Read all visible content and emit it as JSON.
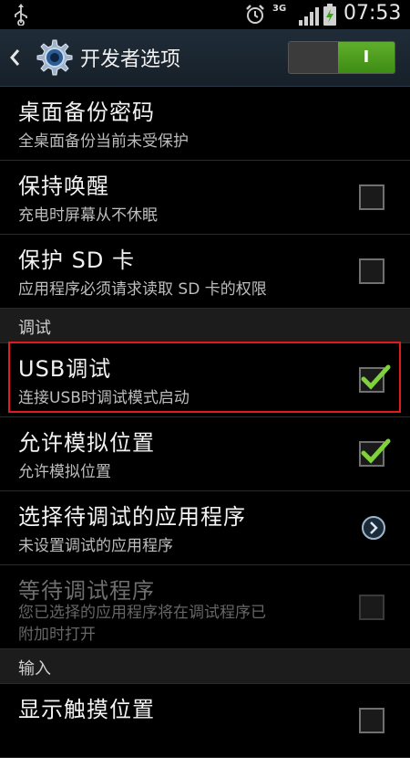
{
  "status_bar": {
    "network": "3G",
    "time": "07:53",
    "icons": [
      "usb-icon",
      "alarm-icon",
      "signal-icon",
      "battery-icon"
    ]
  },
  "action_bar": {
    "title": "开发者选项",
    "toggle_on_label": "I",
    "toggle_state": "on",
    "colors": {
      "accent": "#4c9e20",
      "background": "#1b2631"
    }
  },
  "items": [
    {
      "title": "桌面备份密码",
      "subtitle": "全桌面备份当前未受保护",
      "control": "none"
    },
    {
      "title": "保持唤醒",
      "subtitle": "充电时屏幕从不休眠",
      "control": "checkbox",
      "checked": false
    },
    {
      "title": "保护 SD 卡",
      "subtitle": "应用程序必须请求读取 SD 卡的权限",
      "control": "checkbox",
      "checked": false
    }
  ],
  "section_debug": "调试",
  "debug_items": [
    {
      "title": "USB调试",
      "subtitle": "连接USB时调试模式启动",
      "control": "checkbox",
      "checked": true,
      "highlighted": true
    },
    {
      "title": "允许模拟位置",
      "subtitle": "允许模拟位置",
      "control": "checkbox",
      "checked": true
    },
    {
      "title": "选择待调试的应用程序",
      "subtitle": "未设置调试的应用程序",
      "control": "chevron"
    },
    {
      "title": "等待调试程序",
      "subtitle_line1": "您已选择的应用程序将在调试程序已",
      "subtitle_line2": "附加时打开",
      "control": "checkbox",
      "checked": false,
      "disabled": true
    }
  ],
  "section_input": "输入",
  "input_items": [
    {
      "title": "显示触摸位置",
      "control": "checkbox",
      "checked": false
    }
  ],
  "highlight_color": "#e11b1b"
}
